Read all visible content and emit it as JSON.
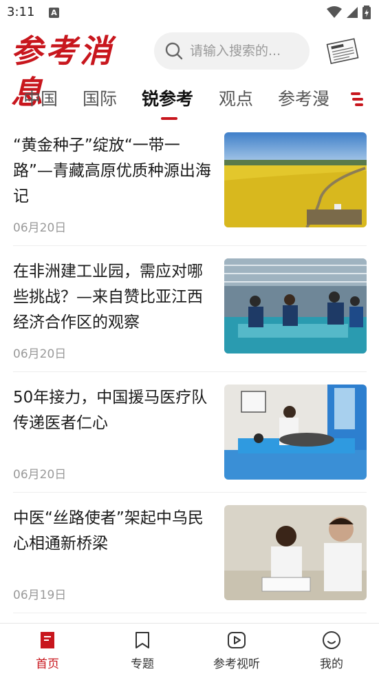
{
  "status_bar": {
    "time": "3:11"
  },
  "header": {
    "logo_text": "参考消息",
    "search_placeholder": "请输入搜索的..."
  },
  "tabs": [
    {
      "label": "中国",
      "active": false
    },
    {
      "label": "国际",
      "active": false
    },
    {
      "label": "锐参考",
      "active": true
    },
    {
      "label": "观点",
      "active": false
    },
    {
      "label": "参考漫",
      "active": false
    }
  ],
  "articles": [
    {
      "title": "“黄金种子”绽放“一带一路”—青藏高原优质种源出海记",
      "date": "06月20日",
      "thumb": "rapeseed-field"
    },
    {
      "title": "在非洲建工业园，需应对哪些挑战？—来自赞比亚江西经济合作区的观察",
      "date": "06月20日",
      "thumb": "factory-workers"
    },
    {
      "title": "50年接力，中国援马医疗队传递医者仁心",
      "date": "06月20日",
      "thumb": "medical-treatment"
    },
    {
      "title": "中医“丝路使者”架起中乌民心相通新桥梁",
      "date": "06月19日",
      "thumb": "doctor-consultation"
    }
  ],
  "bottom_nav": [
    {
      "label": "首页",
      "icon": "home-doc-icon",
      "active": true
    },
    {
      "label": "专题",
      "icon": "bookmark-icon",
      "active": false
    },
    {
      "label": "参考视听",
      "icon": "play-icon",
      "active": false
    },
    {
      "label": "我的",
      "icon": "smile-icon",
      "active": false
    }
  ],
  "colors": {
    "brand_red": "#c8161d",
    "text_dark": "#1a1a1a",
    "text_muted": "#999999"
  }
}
